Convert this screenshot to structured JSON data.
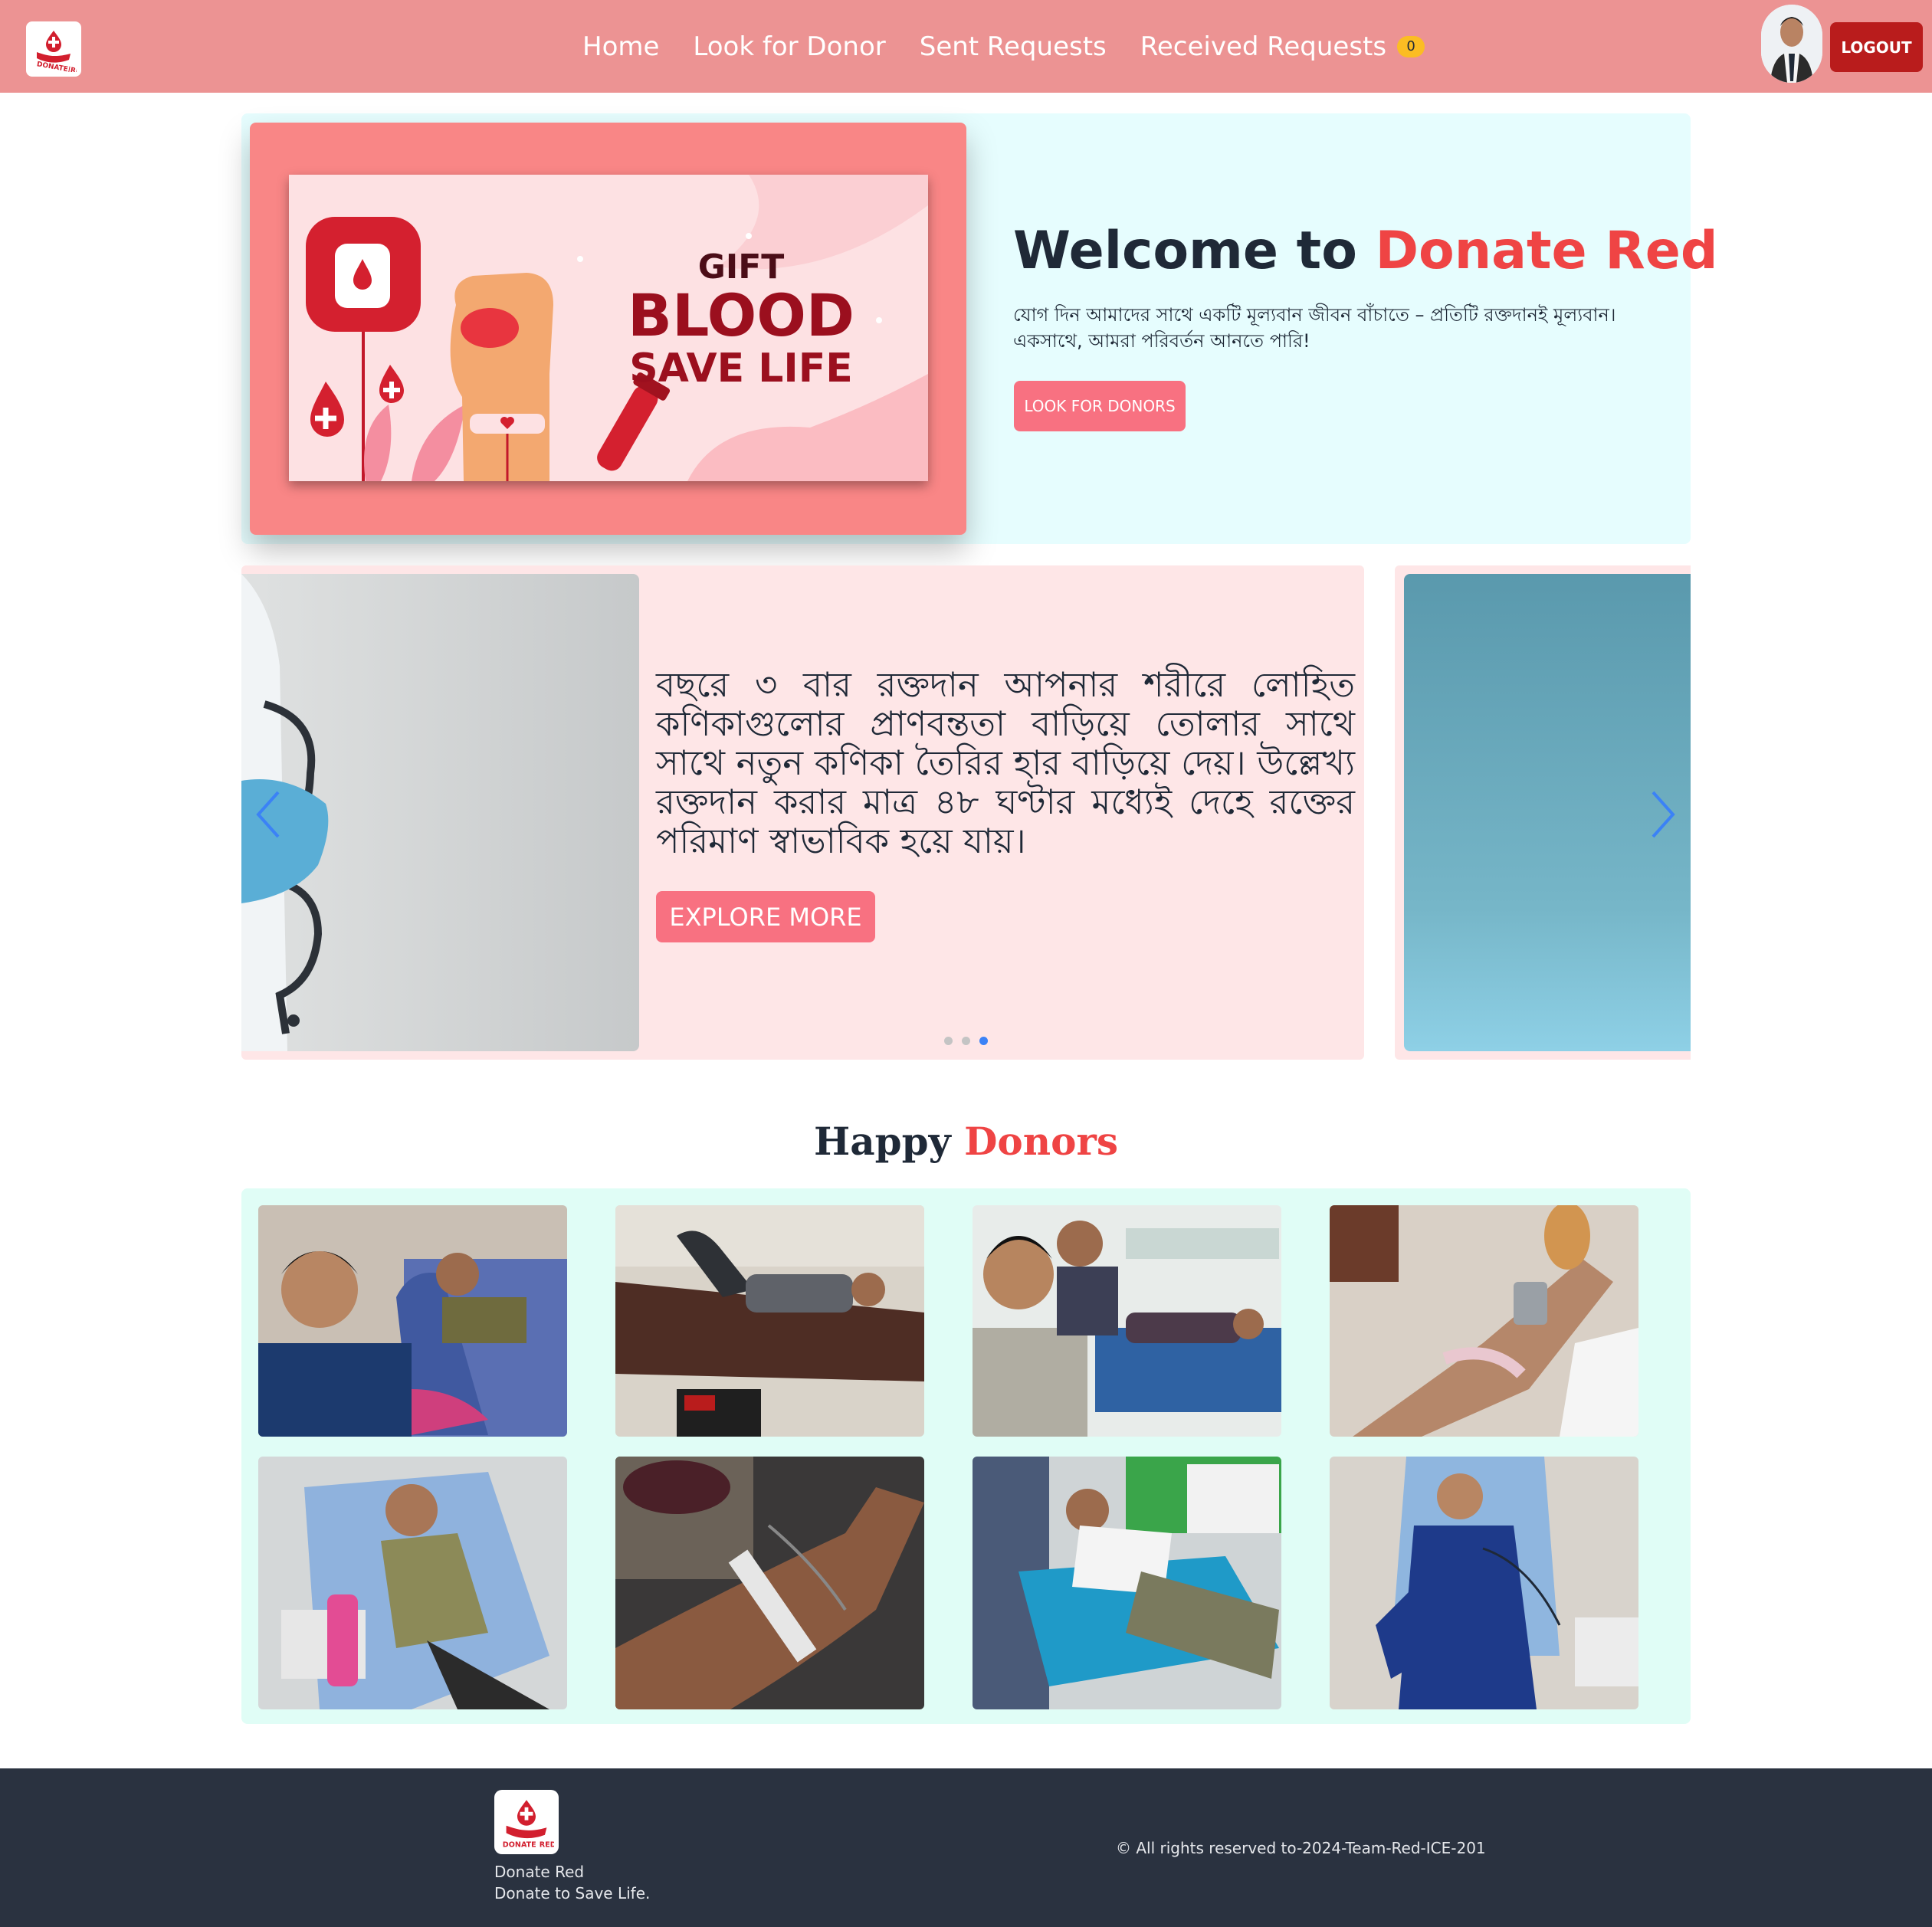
{
  "nav": {
    "links": [
      "Home",
      "Look for Donor",
      "Sent Requests",
      "Received Requests"
    ],
    "received_count": "0",
    "logout_label": "LOGOUT"
  },
  "hero": {
    "image_text": {
      "gift": "GIFT",
      "blood": "BLOOD",
      "save": "SAVE LIFE"
    },
    "title_prefix": "Welcome to ",
    "title_brand": "Donate Red",
    "subtitle": "যোগ দিন আমাদের সাথে একটি মূল্যবান জীবন বাঁচাতে – প্রতিটি রক্তদানই মূল্যবান। একসাথে, আমরা পরিবর্তন আনতে পারি!",
    "button_label": "LOOK FOR DONORS"
  },
  "carousel": {
    "text": "বছরে ৩ বার রক্তদান আপনার শরীরে লোহিত কণিকাগুলোর প্রাণবন্ততা বাড়িয়ে তোলার সাথে সাথে নতুন কণিকা তৈরির হার বাড়িয়ে দেয়। উল্লেখ্য রক্তদান করার মাত্র ৪৮ ঘণ্টার মধ্যেই দেহে রক্তের পরিমাণ স্বাভাবিক হয়ে যায়।",
    "button_label": "EXPLORE MORE",
    "active_slide": 3,
    "slide_count": 3
  },
  "donors": {
    "title_prefix": "Happy ",
    "title_highlight": "Donors"
  },
  "footer": {
    "logo_lines": [
      "DONATE",
      "RED"
    ],
    "name": "Donate Red",
    "tagline": "Donate to Save Life.",
    "copyright": "© All rights reserved to-2024-Team-Red-ICE-201"
  },
  "colors": {
    "navbar": "#ec9393",
    "accent": "#ef4444",
    "button_pink": "#f87181",
    "logout": "#b91c1c",
    "footer": "#2a3240"
  }
}
